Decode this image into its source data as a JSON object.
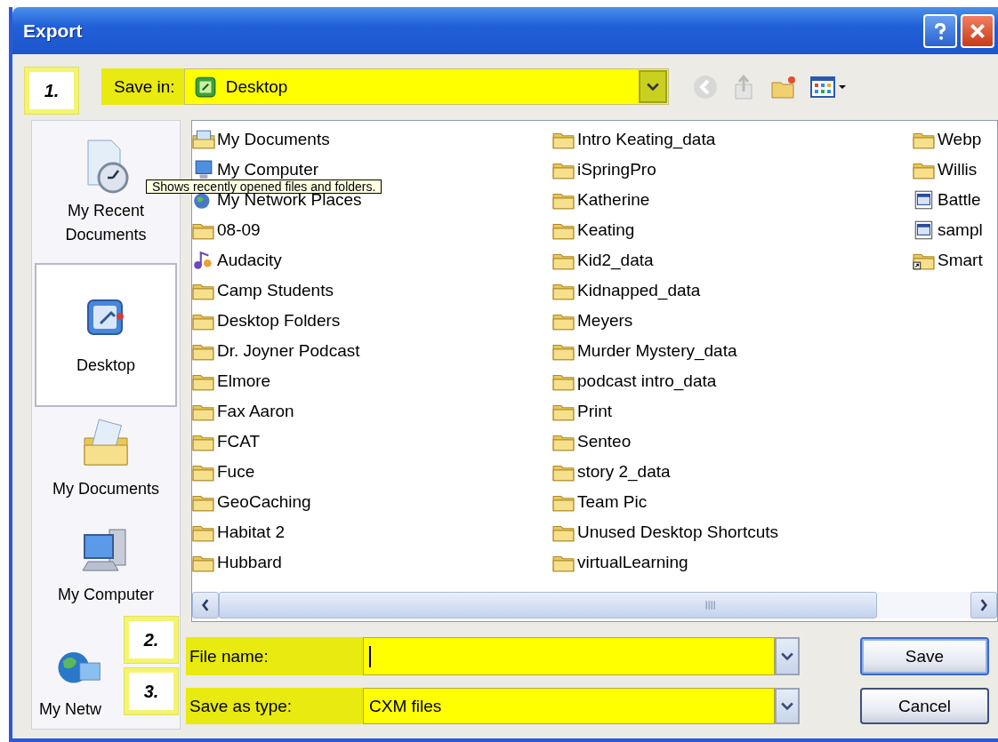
{
  "window": {
    "title": "Export"
  },
  "save_in": {
    "label": "Save in:",
    "value": "Desktop"
  },
  "toolbar": [
    {
      "kind": "back",
      "disabled": true
    },
    {
      "kind": "up",
      "disabled": true
    },
    {
      "kind": "new-folder",
      "disabled": false
    },
    {
      "kind": "views",
      "disabled": false
    }
  ],
  "places": [
    {
      "label": "My Recent Documents",
      "kind": "recent",
      "selected": false
    },
    {
      "label": "Desktop",
      "kind": "desktop",
      "selected": true
    },
    {
      "label": "My Documents",
      "kind": "documents",
      "selected": false
    },
    {
      "label": "My Computer",
      "kind": "computer",
      "selected": false
    },
    {
      "label": "My Netw",
      "kind": "network",
      "selected": false
    }
  ],
  "files": [
    {
      "name": "My Documents",
      "kind": "documents"
    },
    {
      "name": "My Computer",
      "kind": "computer"
    },
    {
      "name": "My Network Places",
      "kind": "network"
    },
    {
      "name": "08-09",
      "kind": "folder"
    },
    {
      "name": "Audacity",
      "kind": "audio"
    },
    {
      "name": "Camp Students",
      "kind": "folder"
    },
    {
      "name": "Desktop Folders",
      "kind": "folder"
    },
    {
      "name": "Dr. Joyner Podcast",
      "kind": "folder"
    },
    {
      "name": "Elmore",
      "kind": "folder"
    },
    {
      "name": "Fax Aaron",
      "kind": "folder"
    },
    {
      "name": "FCAT",
      "kind": "folder"
    },
    {
      "name": "Fuce",
      "kind": "folder"
    },
    {
      "name": "GeoCaching",
      "kind": "folder"
    },
    {
      "name": "Habitat 2",
      "kind": "folder"
    },
    {
      "name": "Hubbard",
      "kind": "folder"
    },
    {
      "name": "Intro Keating_data",
      "kind": "folder"
    },
    {
      "name": "iSpringPro",
      "kind": "folder"
    },
    {
      "name": "Katherine",
      "kind": "folder"
    },
    {
      "name": "Keating",
      "kind": "folder"
    },
    {
      "name": "Kid2_data",
      "kind": "folder"
    },
    {
      "name": "Kidnapped_data",
      "kind": "folder"
    },
    {
      "name": "Meyers",
      "kind": "folder"
    },
    {
      "name": "Murder Mystery_data",
      "kind": "folder"
    },
    {
      "name": "podcast intro_data",
      "kind": "folder"
    },
    {
      "name": "Print",
      "kind": "folder"
    },
    {
      "name": "Senteo",
      "kind": "folder"
    },
    {
      "name": "story 2_data",
      "kind": "folder"
    },
    {
      "name": "Team Pic",
      "kind": "folder"
    },
    {
      "name": "Unused Desktop Shortcuts",
      "kind": "folder"
    },
    {
      "name": "virtualLearning",
      "kind": "folder"
    },
    {
      "name": "Webp",
      "kind": "folder"
    },
    {
      "name": "Willis",
      "kind": "folder"
    },
    {
      "name": "Battle",
      "kind": "web-file"
    },
    {
      "name": "sampl",
      "kind": "web-file"
    },
    {
      "name": "Smart",
      "kind": "folder-shortcut"
    }
  ],
  "tooltip": "Shows recently opened files and folders.",
  "file_name": {
    "label": "File name:"
  },
  "save_as_type": {
    "label": "Save as type:",
    "value": "CXM files"
  },
  "buttons": [
    {
      "label": "Save",
      "default": true
    },
    {
      "label": "Cancel",
      "default": false
    }
  ],
  "callouts": [
    "1.",
    "2.",
    "3."
  ]
}
